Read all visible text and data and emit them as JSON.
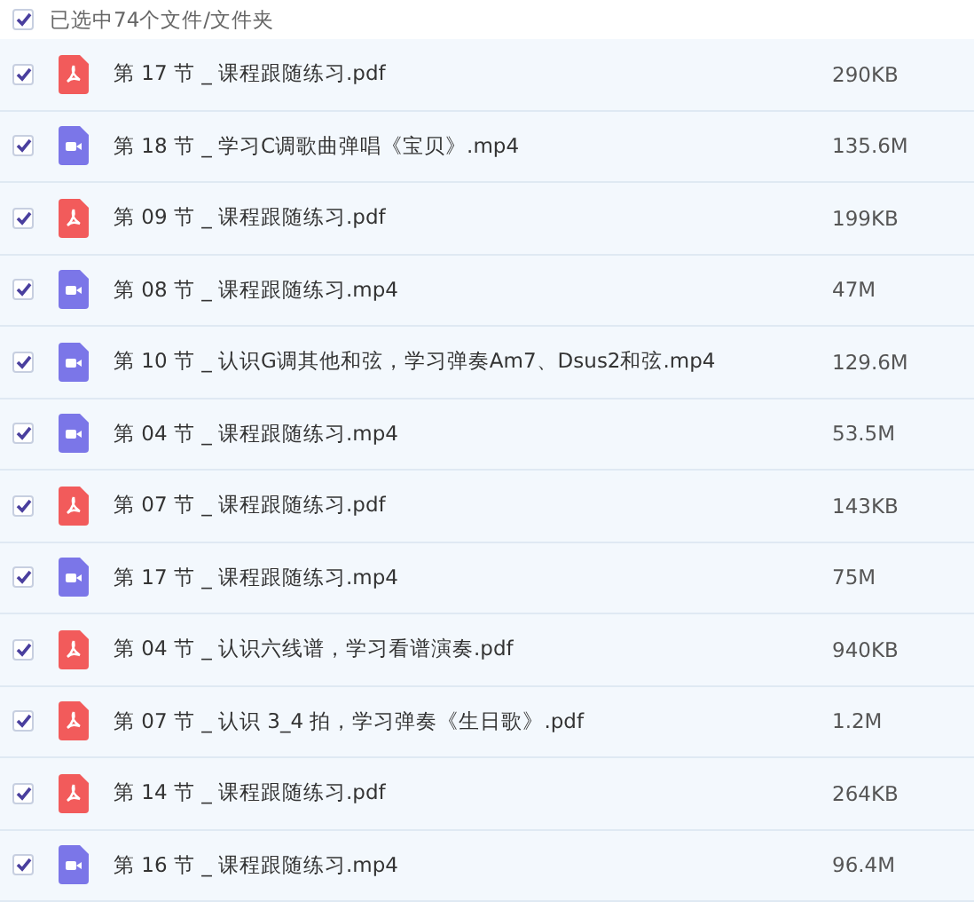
{
  "header": {
    "label": "已选中74个文件/文件夹",
    "checked": true
  },
  "files": [
    {
      "kind": "pdf",
      "name": "第 17 节 _ 课程跟随练习.pdf",
      "size": "290KB",
      "checked": true
    },
    {
      "kind": "video",
      "name": "第 18 节 _ 学习C调歌曲弹唱《宝贝》.mp4",
      "size": "135.6M",
      "checked": true
    },
    {
      "kind": "pdf",
      "name": "第 09 节 _ 课程跟随练习.pdf",
      "size": "199KB",
      "checked": true
    },
    {
      "kind": "video",
      "name": "第 08 节 _ 课程跟随练习.mp4",
      "size": "47M",
      "checked": true
    },
    {
      "kind": "video",
      "name": "第 10 节 _ 认识G调其他和弦，学习弹奏Am7、Dsus2和弦.mp4",
      "size": "129.6M",
      "checked": true
    },
    {
      "kind": "video",
      "name": "第 04 节 _ 课程跟随练习.mp4",
      "size": "53.5M",
      "checked": true
    },
    {
      "kind": "pdf",
      "name": "第 07 节 _ 课程跟随练习.pdf",
      "size": "143KB",
      "checked": true
    },
    {
      "kind": "video",
      "name": "第 17 节 _ 课程跟随练习.mp4",
      "size": "75M",
      "checked": true
    },
    {
      "kind": "pdf",
      "name": "第 04 节 _ 认识六线谱，学习看谱演奏.pdf",
      "size": "940KB",
      "checked": true
    },
    {
      "kind": "pdf",
      "name": "第 07 节 _ 认识 3_4 拍，学习弹奏《生日歌》.pdf",
      "size": "1.2M",
      "checked": true
    },
    {
      "kind": "pdf",
      "name": "第 14 节 _ 课程跟随练习.pdf",
      "size": "264KB",
      "checked": true
    },
    {
      "kind": "video",
      "name": "第 16 节 _ 课程跟随练习.mp4",
      "size": "96.4M",
      "checked": true
    }
  ]
}
